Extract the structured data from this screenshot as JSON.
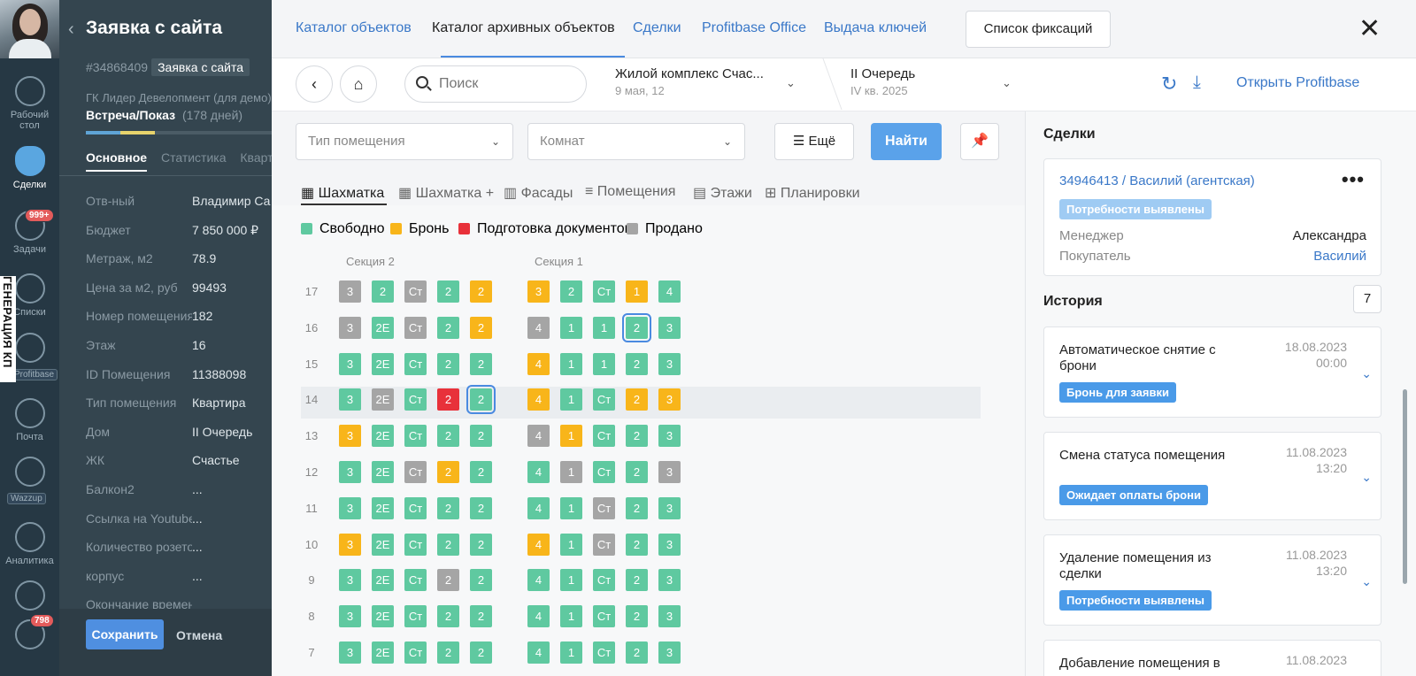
{
  "nav": {
    "items": [
      {
        "label": "Рабочий стол"
      },
      {
        "label": "Сделки"
      },
      {
        "label": "Задачи",
        "badge": "999+"
      },
      {
        "label": "Списки"
      },
      {
        "label": "Profitbase"
      },
      {
        "label": "Почта"
      },
      {
        "label": "Wazzup"
      },
      {
        "label": "Аналитика"
      }
    ],
    "chat_badge": "798",
    "vertical_label": "ГЕНЕРАЦИЯ КП"
  },
  "lead": {
    "title": "Заявка с сайта",
    "number": "#34868409",
    "number_tag": "Заявка с сайта",
    "org": "ГК Лидер Девелопмент (для демо)",
    "stage": "Встреча/Показ",
    "stage_days": "(178 дней)",
    "tabs": [
      "Основное",
      "Статистика",
      "Квартира"
    ],
    "fields": [
      {
        "k": "Отв-ный",
        "v": "Владимир Са"
      },
      {
        "k": "Бюджет",
        "v": "7 850 000 ₽"
      },
      {
        "k": "Метраж, м2",
        "v": "78.9"
      },
      {
        "k": "Цена за м2, руб",
        "v": "99493"
      },
      {
        "k": "Номер помещения",
        "v": "182"
      },
      {
        "k": "Этаж",
        "v": "16"
      },
      {
        "k": "ID Помещения",
        "v": "11388098"
      },
      {
        "k": "Тип помещения",
        "v": "Квартира"
      },
      {
        "k": "Дом",
        "v": "II Очередь"
      },
      {
        "k": "ЖК",
        "v": "Счастье"
      },
      {
        "k": "Балкон2",
        "v": "..."
      },
      {
        "k": "Ссылка на Youtube",
        "v": "..."
      },
      {
        "k": "Количество розеток",
        "v": "..."
      },
      {
        "k": "корпус",
        "v": "..."
      },
      {
        "k": "Окончание времени",
        "v": ""
      }
    ],
    "save": "Сохранить",
    "cancel": "Отмена"
  },
  "tabs": [
    "Каталог объектов",
    "Каталог архивных объектов",
    "Сделки",
    "Profitbase Office",
    "Выдача ключей"
  ],
  "fix_list": "Список фиксаций",
  "close": "✕",
  "toolbar": {
    "search_placeholder": "Поиск",
    "complex": "Жилой комплекс Счас...",
    "complex_date": "9 мая, 12",
    "queue": "II Очередь",
    "queue_date": "IV кв. 2025",
    "open_pb": "Открыть Profitbase"
  },
  "filters": {
    "type_placeholder": "Тип помещения",
    "rooms_placeholder": "Комнат",
    "more": "Ещё",
    "find": "Найти"
  },
  "view_tabs": [
    "Шахматка",
    "Шахматка +",
    "Фасады",
    "Помещения",
    "Этажи",
    "Планировки"
  ],
  "legend": [
    {
      "label": "Свободно",
      "color": "#5fc9a0"
    },
    {
      "label": "Бронь",
      "color": "#f8b51a"
    },
    {
      "label": "Подготовка документов",
      "color": "#e8313a"
    },
    {
      "label": "Продано",
      "color": "#a5a5a5"
    }
  ],
  "status_colors": {
    "F": "#5fc9a0",
    "B": "#f8b51a",
    "D": "#e8313a",
    "S": "#a5a5a5"
  },
  "sections": [
    "Секция 2",
    "Секция 1"
  ],
  "grid": [
    {
      "floor": "17",
      "s2": [
        [
          "3",
          "S"
        ],
        [
          "2",
          "F"
        ],
        [
          "Ст",
          "S"
        ],
        [
          "2",
          "F"
        ],
        [
          "2",
          "B"
        ]
      ],
      "s1": [
        [
          "3",
          "B"
        ],
        [
          "2",
          "F"
        ],
        [
          "Ст",
          "F"
        ],
        [
          "1",
          "B"
        ],
        [
          "4",
          "F"
        ]
      ]
    },
    {
      "floor": "16",
      "s2": [
        [
          "3",
          "S"
        ],
        [
          "2Е",
          "F"
        ],
        [
          "Ст",
          "S"
        ],
        [
          "2",
          "F"
        ],
        [
          "2",
          "B"
        ]
      ],
      "s1": [
        [
          "4",
          "S"
        ],
        [
          "1",
          "F"
        ],
        [
          "1",
          "F"
        ],
        [
          "2",
          "F",
          "sel"
        ],
        [
          "3",
          "F"
        ]
      ]
    },
    {
      "floor": "15",
      "s2": [
        [
          "3",
          "F"
        ],
        [
          "2Е",
          "F"
        ],
        [
          "Ст",
          "F"
        ],
        [
          "2",
          "F"
        ],
        [
          "2",
          "F"
        ]
      ],
      "s1": [
        [
          "4",
          "B"
        ],
        [
          "1",
          "F"
        ],
        [
          "1",
          "F"
        ],
        [
          "2",
          "F"
        ],
        [
          "3",
          "F"
        ]
      ]
    },
    {
      "floor": "14",
      "s2": [
        [
          "3",
          "F"
        ],
        [
          "2Е",
          "S"
        ],
        [
          "Ст",
          "F"
        ],
        [
          "2",
          "D"
        ],
        [
          "2",
          "F",
          "sel"
        ]
      ],
      "s1": [
        [
          "4",
          "B"
        ],
        [
          "1",
          "F"
        ],
        [
          "Ст",
          "F"
        ],
        [
          "2",
          "B"
        ],
        [
          "3",
          "B"
        ]
      ]
    },
    {
      "floor": "13",
      "s2": [
        [
          "3",
          "B"
        ],
        [
          "2Е",
          "F"
        ],
        [
          "Ст",
          "F"
        ],
        [
          "2",
          "F"
        ],
        [
          "2",
          "F"
        ]
      ],
      "s1": [
        [
          "4",
          "S"
        ],
        [
          "1",
          "B"
        ],
        [
          "Ст",
          "F"
        ],
        [
          "2",
          "F"
        ],
        [
          "3",
          "F"
        ]
      ]
    },
    {
      "floor": "12",
      "s2": [
        [
          "3",
          "F"
        ],
        [
          "2Е",
          "F"
        ],
        [
          "Ст",
          "S"
        ],
        [
          "2",
          "B"
        ],
        [
          "2",
          "F"
        ]
      ],
      "s1": [
        [
          "4",
          "F"
        ],
        [
          "1",
          "S"
        ],
        [
          "Ст",
          "F"
        ],
        [
          "2",
          "F"
        ],
        [
          "3",
          "S"
        ]
      ]
    },
    {
      "floor": "11",
      "s2": [
        [
          "3",
          "F"
        ],
        [
          "2Е",
          "F"
        ],
        [
          "Ст",
          "F"
        ],
        [
          "2",
          "F"
        ],
        [
          "2",
          "F"
        ]
      ],
      "s1": [
        [
          "4",
          "F"
        ],
        [
          "1",
          "F"
        ],
        [
          "Ст",
          "S"
        ],
        [
          "2",
          "F"
        ],
        [
          "3",
          "F"
        ]
      ]
    },
    {
      "floor": "10",
      "s2": [
        [
          "3",
          "B"
        ],
        [
          "2Е",
          "F"
        ],
        [
          "Ст",
          "F"
        ],
        [
          "2",
          "F"
        ],
        [
          "2",
          "F"
        ]
      ],
      "s1": [
        [
          "4",
          "B"
        ],
        [
          "1",
          "F"
        ],
        [
          "Ст",
          "S"
        ],
        [
          "2",
          "F"
        ],
        [
          "3",
          "F"
        ]
      ]
    },
    {
      "floor": "9",
      "s2": [
        [
          "3",
          "F"
        ],
        [
          "2Е",
          "F"
        ],
        [
          "Ст",
          "F"
        ],
        [
          "2",
          "S"
        ],
        [
          "2",
          "F"
        ]
      ],
      "s1": [
        [
          "4",
          "F"
        ],
        [
          "1",
          "F"
        ],
        [
          "Ст",
          "F"
        ],
        [
          "2",
          "F"
        ],
        [
          "3",
          "F"
        ]
      ]
    },
    {
      "floor": "8",
      "s2": [
        [
          "3",
          "F"
        ],
        [
          "2Е",
          "F"
        ],
        [
          "Ст",
          "F"
        ],
        [
          "2",
          "F"
        ],
        [
          "2",
          "F"
        ]
      ],
      "s1": [
        [
          "4",
          "F"
        ],
        [
          "1",
          "F"
        ],
        [
          "Ст",
          "F"
        ],
        [
          "2",
          "F"
        ],
        [
          "3",
          "F"
        ]
      ]
    },
    {
      "floor": "7",
      "s2": [
        [
          "3",
          "F"
        ],
        [
          "2Е",
          "F"
        ],
        [
          "Ст",
          "F"
        ],
        [
          "2",
          "F"
        ],
        [
          "2",
          "F"
        ]
      ],
      "s1": [
        [
          "4",
          "F"
        ],
        [
          "1",
          "F"
        ],
        [
          "Ст",
          "F"
        ],
        [
          "2",
          "F"
        ],
        [
          "3",
          "F"
        ]
      ]
    }
  ],
  "right": {
    "deals_title": "Сделки",
    "deal": {
      "link": "34946413 / Василий (агентская)",
      "status": "Потребности выявлены",
      "manager_k": "Менеджер",
      "manager_v": "Александра",
      "buyer_k": "Покупатель",
      "buyer_v": "Василий"
    },
    "history_title": "История",
    "history_count": "7",
    "history": [
      {
        "title": "Автоматическое снятие с брони",
        "date": "18.08.2023",
        "time": "00:00",
        "tag": "Бронь для заявки"
      },
      {
        "title": "Смена статуса помещения",
        "date": "11.08.2023",
        "time": "13:20",
        "tag": "Ожидает оплаты брони"
      },
      {
        "title": "Удаление помещения из сделки",
        "date": "11.08.2023",
        "time": "13:20",
        "tag": "Потребности выявлены"
      },
      {
        "title": "Добавление помещения в",
        "date": "11.08.2023",
        "time": "",
        "tag": ""
      }
    ]
  }
}
